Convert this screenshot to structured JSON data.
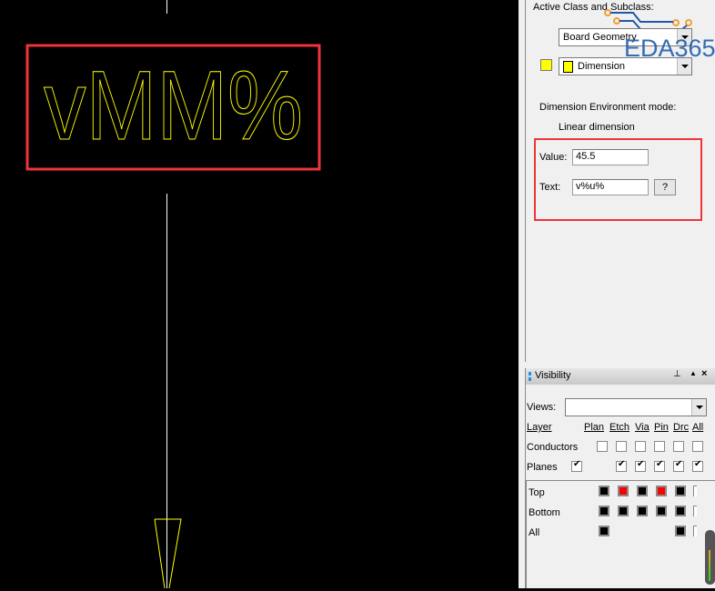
{
  "canvas": {
    "dimension_text": "vMM%",
    "line_color": "#ffffff",
    "text_color": "#ffff00",
    "highlight_color": "#f0343a"
  },
  "options": {
    "active_class_label": "Active Class and Subclass:",
    "class_value": "Board Geometry",
    "subclass_value": "Dimension",
    "subclass_color": "#ffff00",
    "env_mode_label": "Dimension Environment mode:",
    "env_mode_value": "Linear dimension",
    "value_label": "Value:",
    "value": "45.5",
    "text_label": "Text:",
    "text_value": "v%u%",
    "help_button": "?",
    "watermark": "EDA365"
  },
  "visibility": {
    "title": "Visibility",
    "views_label": "Views:",
    "views_value": "",
    "columns": [
      "Layer",
      "Plan",
      "Etch",
      "Via",
      "Pin",
      "Drc",
      "All"
    ],
    "rows": [
      {
        "label": "Conductors",
        "plan": false,
        "checks": [
          false,
          false,
          false,
          false,
          false,
          false
        ]
      },
      {
        "label": "Planes",
        "plan": true,
        "checks": [
          true,
          true,
          true,
          true,
          true
        ]
      }
    ],
    "layers": [
      {
        "label": "Top",
        "colors": [
          "black",
          "red",
          "black",
          "red",
          "black"
        ]
      },
      {
        "label": "Bottom",
        "colors": [
          "black",
          "black",
          "black",
          "black",
          "black"
        ]
      },
      {
        "label": "All",
        "colors": [
          "black",
          null,
          null,
          null,
          "black"
        ]
      }
    ]
  }
}
